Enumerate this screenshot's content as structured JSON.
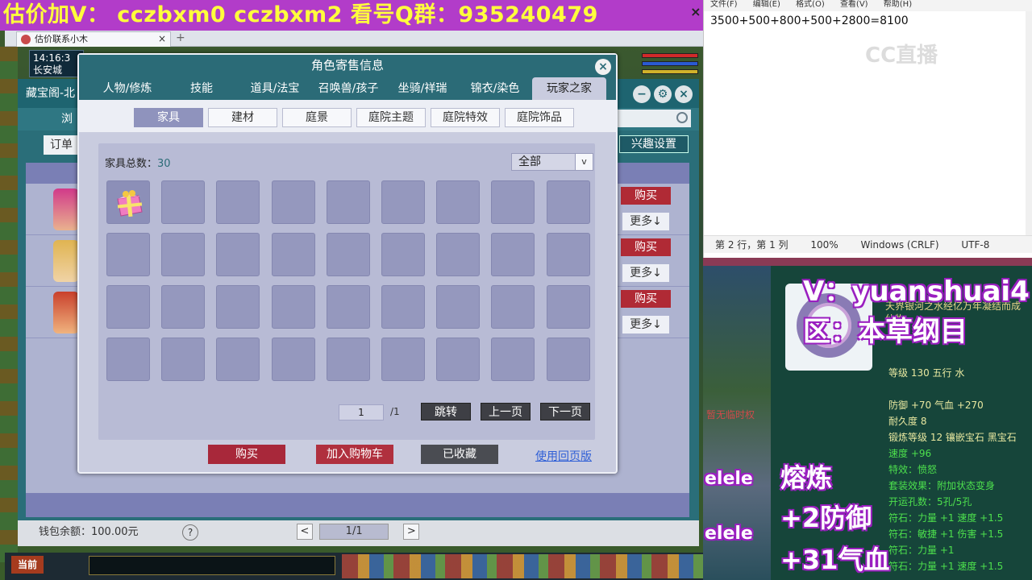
{
  "promo": {
    "text": "估价加V：  cczbxm0   cczbxm2   看号Q群：935240479",
    "close": "×"
  },
  "browser": {
    "tab_title": "估价联系小木",
    "tab_close": "×",
    "new_tab": "+"
  },
  "hud": {
    "time": "14:16:3",
    "city": "长安城"
  },
  "cbg": {
    "title": "藏宝阁-北",
    "nav_label": "浏",
    "filter_label": "订单",
    "interest_button": "兴趣设置",
    "buy_label": "购买",
    "more_label": "更多↓",
    "wallet_label": "钱包余额：100.00元",
    "help": "?",
    "pager_prev": "<",
    "pager_value": "1/1",
    "pager_next": ">",
    "colors": {
      "window": "#2a6e79",
      "buy": "#b02a35"
    }
  },
  "game_bottom": {
    "current_channel": "当前"
  },
  "modal": {
    "title": "角色寄售信息",
    "close": "×",
    "tabs": [
      "人物/修炼",
      "技能",
      "道具/法宝",
      "召唤兽/孩子",
      "坐骑/祥瑞",
      "锦衣/染色",
      "玩家之家"
    ],
    "active_tab": 6,
    "subtabs": [
      "家具",
      "建材",
      "庭景",
      "庭院主题",
      "庭院特效",
      "庭院饰品"
    ],
    "active_subtab": 0,
    "count_label": "家具总数：",
    "count_value": "30",
    "filter_value": "全部",
    "filter_chevron": "v",
    "grid_rows": 4,
    "grid_cols": 9,
    "grid_items": [
      {
        "index": 0,
        "icon": "gift-box-icon"
      }
    ],
    "page_current": "1",
    "page_total": "/1",
    "jump_button": "跳转",
    "prev_button": "上一页",
    "next_button": "下一页",
    "buy_button": "购买",
    "cart_button": "加入购物车",
    "fav_button": "已收藏",
    "old_version_link": "使用回页版",
    "colors": {
      "header": "#2b6b77",
      "buy": "#a8283a",
      "cart": "#b0303e",
      "fav": "#4a4c52",
      "link": "#2f5fd6"
    }
  },
  "notepad": {
    "menu": [
      "文件(F)",
      "编辑(E)",
      "格式(O)",
      "查看(V)",
      "帮助(H)"
    ],
    "content": "3500+500+800+500+2800=8100",
    "watermark": "CC直播",
    "status": [
      "第 2 行，第 1 列",
      "100%",
      "Windows (CRLF)",
      "UTF-8"
    ]
  },
  "right_panel": {
    "streamer_id": "V：yuanshuai4",
    "server_name": "区：本草纲目",
    "item_desc_lines": [
      "天界银河之水经亿万年凝结而成",
      "仙物。"
    ],
    "stats": [
      {
        "text": "等级 130  五行 水",
        "color": "yellow"
      },
      {
        "text": "防御 +70  气血 +270",
        "color": "yellow"
      },
      {
        "text": "耐久度 8",
        "color": "yellow"
      },
      {
        "text": "锻炼等级 12  镶嵌宝石 黑宝石",
        "color": "yellow"
      },
      {
        "text": "速度 +96",
        "color": "green"
      },
      {
        "text": "特效：愤怒",
        "color": "green"
      },
      {
        "text": "套装效果：附加状态变身",
        "color": "green"
      },
      {
        "text": "开运孔数：5孔/5孔",
        "color": "green"
      },
      {
        "text": "符石：力量 +1  速度 +1.5",
        "color": "green"
      },
      {
        "text": "符石：敏捷 +1  伤害 +1.5",
        "color": "green"
      },
      {
        "text": "符石：力量 +1",
        "color": "green"
      },
      {
        "text": "符石：力量 +1  速度 +1.5",
        "color": "green"
      }
    ],
    "overlay_smelt": "熔炼",
    "overlay_def": "+2防御",
    "overlay_hp": "+31气血",
    "elele": "elele",
    "left_labels": [
      "暂无临时权"
    ]
  }
}
